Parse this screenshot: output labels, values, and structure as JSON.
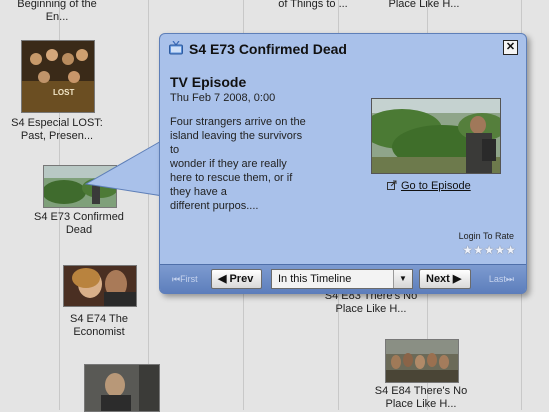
{
  "timeline": {
    "top_labels": [
      {
        "text": "Beginning of the\nEn..."
      },
      {
        "text": "of Things to ..."
      },
      {
        "text": "Place Like H..."
      }
    ],
    "episodes": [
      {
        "label": "S4 Especial LOST:\nPast, Presen..."
      },
      {
        "label": "S4 E73 Confirmed\nDead"
      },
      {
        "label": "S4 E74 The\nEconomist"
      },
      {
        "label": "S4 E83 There's No\nPlace Like H..."
      },
      {
        "label": "S4 E84 There's No\nPlace Like H..."
      }
    ]
  },
  "popup": {
    "title": "S4 E73 Confirmed Dead",
    "kind": "TV Episode",
    "date": "Thu Feb 7 2008, 0:00",
    "description": "Four strangers arrive on the\nisland leaving the survivors\nto\nwonder if they are really\nhere to rescue them, or if\nthey have a\ndifferent purpos....",
    "go_to_label": "Go to Episode",
    "login_label": "Login To Rate",
    "stars": "★★★★★",
    "close_label": "✕",
    "nav": {
      "first": "First",
      "prev": "Prev",
      "select_value": "In this Timeline",
      "next": "Next",
      "last": "Last"
    }
  },
  "colors": {
    "popup_bg": "#a9c1ea",
    "nav_bg": "#5c7dbb",
    "page_bg": "#e4e4e4"
  }
}
